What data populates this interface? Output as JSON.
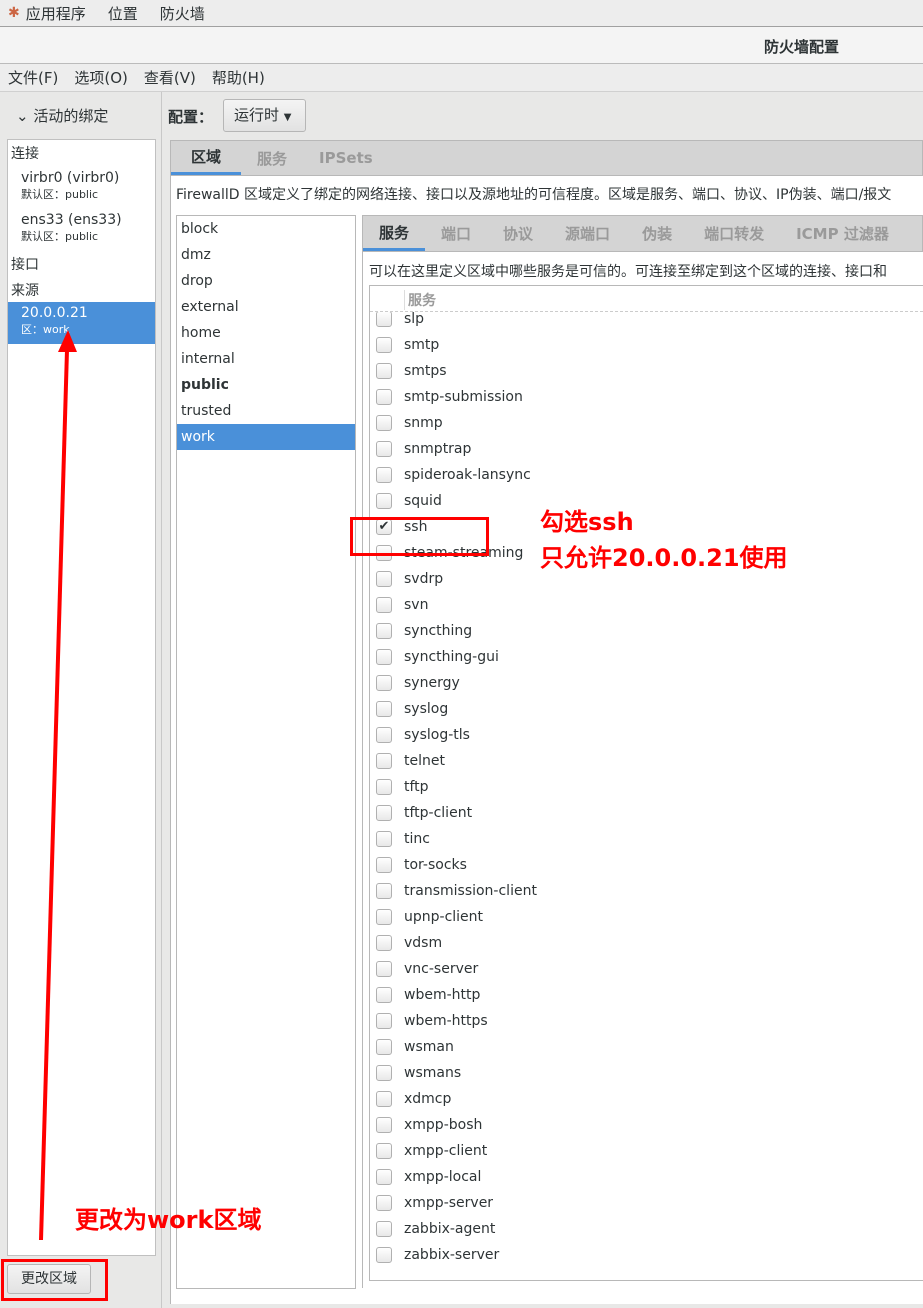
{
  "topbar": {
    "items": [
      "应用程序",
      "位置",
      "防火墙"
    ]
  },
  "window": {
    "title": "防火墙配置"
  },
  "menu": [
    "文件(F)",
    "选项(O)",
    "查看(V)",
    "帮助(H)"
  ],
  "bindings": {
    "header": "活动的绑定",
    "connections_label": "连接",
    "connections": [
      {
        "name": "virbr0 (virbr0)",
        "zone": "默认区：public"
      },
      {
        "name": "ens33 (ens33)",
        "zone": "默认区：public"
      }
    ],
    "interfaces_label": "接口",
    "sources_label": "来源",
    "source": {
      "name": "20.0.0.21",
      "zone": "区：work"
    },
    "change_zone_button": "更改区域"
  },
  "config": {
    "label": "配置：",
    "value": "运行时"
  },
  "outer_tabs": [
    "区域",
    "服务",
    "IPSets"
  ],
  "zone_description": "FirewallD 区域定义了绑定的网络连接、接口以及源地址的可信程度。区域是服务、端口、协议、IP伪装、端口/报文",
  "zones": [
    "block",
    "dmz",
    "drop",
    "external",
    "home",
    "internal",
    "public",
    "trusted",
    "work"
  ],
  "default_zone": "public",
  "selected_zone": "work",
  "inner_tabs": [
    "服务",
    "端口",
    "协议",
    "源端口",
    "伪装",
    "端口转发",
    "ICMP 过滤器"
  ],
  "service_description": "可以在这里定义区域中哪些服务是可信的。可连接至绑定到这个区域的连接、接口和",
  "service_column": "服务",
  "services": [
    {
      "name": "slp",
      "checked": false
    },
    {
      "name": "smtp",
      "checked": false
    },
    {
      "name": "smtps",
      "checked": false
    },
    {
      "name": "smtp-submission",
      "checked": false
    },
    {
      "name": "snmp",
      "checked": false
    },
    {
      "name": "snmptrap",
      "checked": false
    },
    {
      "name": "spideroak-lansync",
      "checked": false
    },
    {
      "name": "squid",
      "checked": false
    },
    {
      "name": "ssh",
      "checked": true
    },
    {
      "name": "steam-streaming",
      "checked": false
    },
    {
      "name": "svdrp",
      "checked": false
    },
    {
      "name": "svn",
      "checked": false
    },
    {
      "name": "syncthing",
      "checked": false
    },
    {
      "name": "syncthing-gui",
      "checked": false
    },
    {
      "name": "synergy",
      "checked": false
    },
    {
      "name": "syslog",
      "checked": false
    },
    {
      "name": "syslog-tls",
      "checked": false
    },
    {
      "name": "telnet",
      "checked": false
    },
    {
      "name": "tftp",
      "checked": false
    },
    {
      "name": "tftp-client",
      "checked": false
    },
    {
      "name": "tinc",
      "checked": false
    },
    {
      "name": "tor-socks",
      "checked": false
    },
    {
      "name": "transmission-client",
      "checked": false
    },
    {
      "name": "upnp-client",
      "checked": false
    },
    {
      "name": "vdsm",
      "checked": false
    },
    {
      "name": "vnc-server",
      "checked": false
    },
    {
      "name": "wbem-http",
      "checked": false
    },
    {
      "name": "wbem-https",
      "checked": false
    },
    {
      "name": "wsman",
      "checked": false
    },
    {
      "name": "wsmans",
      "checked": false
    },
    {
      "name": "xdmcp",
      "checked": false
    },
    {
      "name": "xmpp-bosh",
      "checked": false
    },
    {
      "name": "xmpp-client",
      "checked": false
    },
    {
      "name": "xmpp-local",
      "checked": false
    },
    {
      "name": "xmpp-server",
      "checked": false
    },
    {
      "name": "zabbix-agent",
      "checked": false
    },
    {
      "name": "zabbix-server",
      "checked": false
    }
  ],
  "annotations": {
    "ssh_note_1": "勾选ssh",
    "ssh_note_2": "只允许20.0.0.21使用",
    "zone_note": "更改为work区域",
    "color": "#ff0000"
  },
  "colors": {
    "selection": "#4a90d9"
  }
}
